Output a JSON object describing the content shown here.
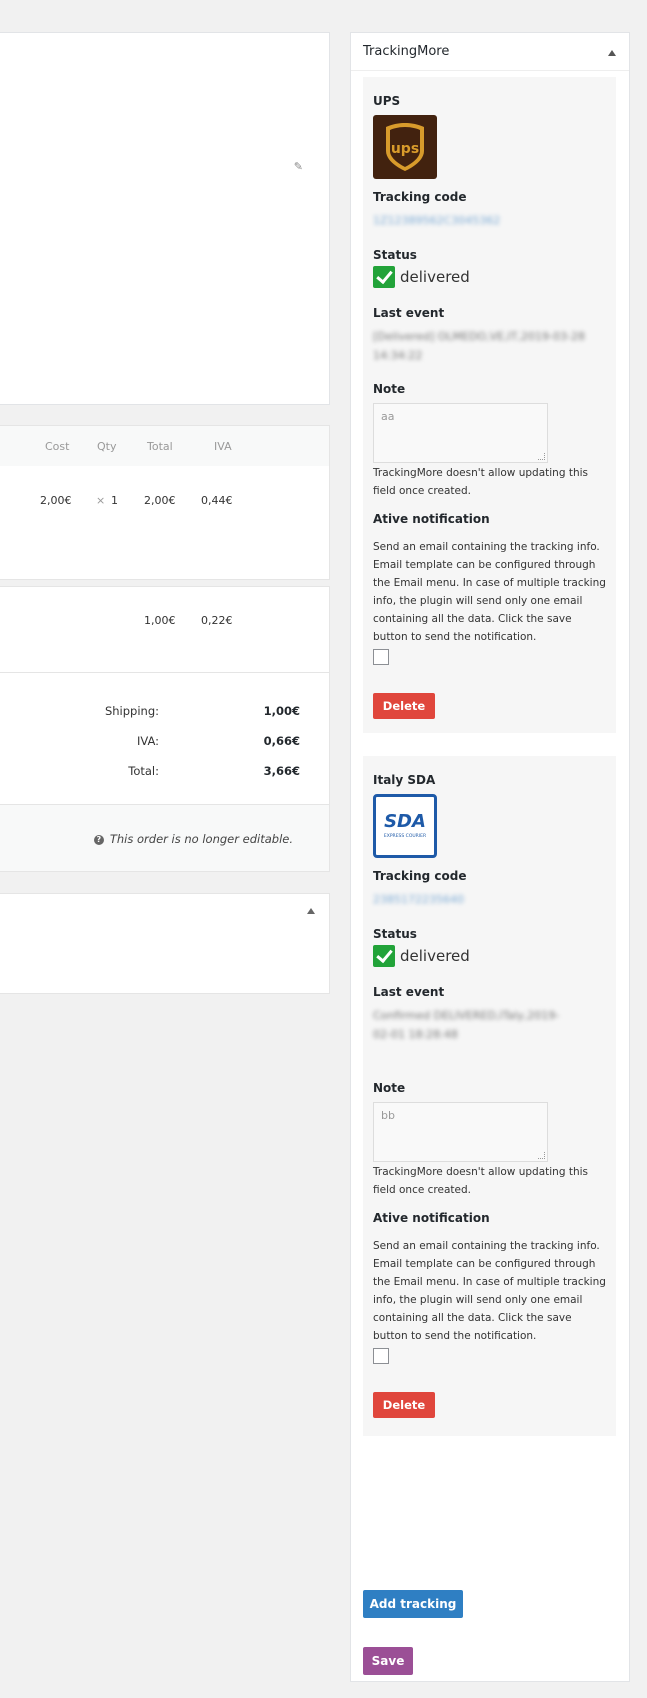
{
  "left": {
    "columns": [
      "Cost",
      "Qty",
      "Total",
      "IVA"
    ],
    "item_row": {
      "cost": "2,00€",
      "qty_prefix": "×",
      "qty": "1",
      "total": "2,00€",
      "iva": "0,44€"
    },
    "shipping_row": {
      "total": "1,00€",
      "iva": "0,22€"
    },
    "totals": [
      {
        "label": "Shipping:",
        "value": "1,00€"
      },
      {
        "label": "IVA:",
        "value": "0,66€"
      },
      {
        "label": "Total:",
        "value": "3,66€"
      }
    ],
    "not_editable_note": "This order is no longer editable."
  },
  "panel": {
    "title": "TrackingMore",
    "trackings": [
      {
        "carrier": "UPS",
        "tracking_code_label": "Tracking code",
        "tracking_code": "1Z12389562C3045362",
        "status_label": "Status",
        "status": "delivered",
        "last_event_label": "Last event",
        "last_event": "[Delivered] OLMEDO,VE,IT,2019-03-28 14:34:22",
        "note_label": "Note",
        "note": "aa",
        "note_help": "TrackingMore doesn't allow updating this field once created.",
        "notify_label": "Ative notification",
        "notify_text": "Send an email containing the tracking info. Email template can be configured through the Email menu. In case of multiple tracking info, the plugin will send only one email containing all the data. Click the save button to send the notification.",
        "delete_label": "Delete"
      },
      {
        "carrier": "Italy SDA",
        "tracking_code_label": "Tracking code",
        "tracking_code": "2385172235640",
        "status_label": "Status",
        "status": "delivered",
        "last_event_label": "Last event",
        "last_event": "Confirmed DELIVERED,ITaly,2019-02-01 18:28:48",
        "note_label": "Note",
        "note": "bb",
        "note_help": "TrackingMore doesn't allow updating this field once created.",
        "notify_label": "Ative notification",
        "notify_text": "Send an email containing the tracking info. Email template can be configured through the Email menu. In case of multiple tracking info, the plugin will send only one email containing all the data. Click the save button to send the notification.",
        "delete_label": "Delete"
      }
    ],
    "add_tracking_label": "Add tracking",
    "save_label": "Save"
  },
  "logos": {
    "ups_text": "ups",
    "sda_text": "SDA",
    "sda_sub": "EXPRESS COURIER"
  },
  "colors": {
    "delete_red": "#e0463c",
    "add_blue": "#2f7fc3",
    "save_purple": "#9b4f96",
    "status_green": "#22a339"
  }
}
